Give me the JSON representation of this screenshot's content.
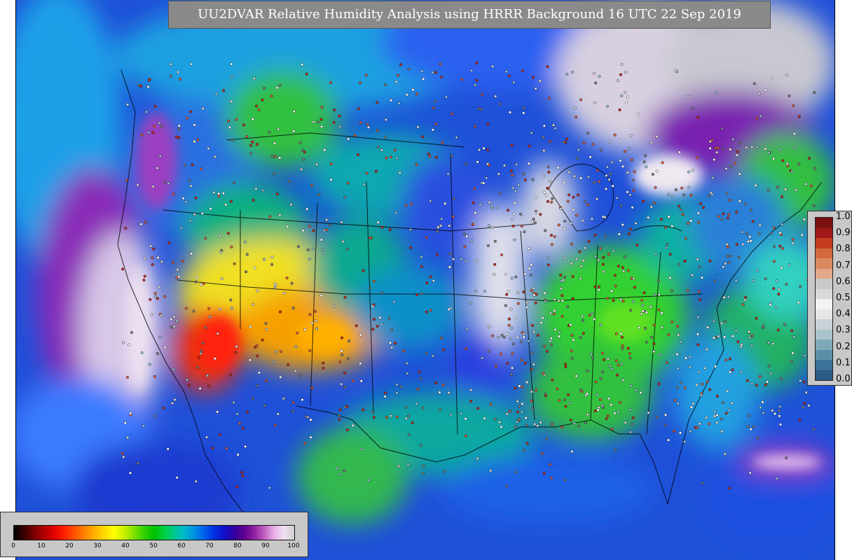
{
  "title": "UU2DVAR Relative Humidity Analysis using HRRR Background 16 UTC 22 Sep 2019",
  "bias_legend": {
    "ticks": [
      "1.0",
      "0.9",
      "0.8",
      "0.7",
      "0.6",
      "0.5",
      "0.4",
      "0.3",
      "0.2",
      "0.1",
      "0.0"
    ],
    "colors": [
      "#2b5a86",
      "#3d7398",
      "#5a8ea8",
      "#7eaab8",
      "#a9c3cc",
      "#c8d2d6",
      "#e6e6e6",
      "#f2f2f2",
      "#d8d8d8",
      "#c8c8c8",
      "#e3a88a",
      "#d98860",
      "#d2683c",
      "#c43c20",
      "#a01818",
      "#7a1010"
    ]
  },
  "rh_legend": {
    "ticks": [
      "0",
      "10",
      "20",
      "30",
      "40",
      "50",
      "60",
      "70",
      "80",
      "90",
      "100"
    ],
    "colors": [
      "#000000",
      "#3a0000",
      "#7a0000",
      "#b00000",
      "#e00000",
      "#ff2000",
      "#ff5000",
      "#ff8000",
      "#ffb000",
      "#ffd800",
      "#ffff00",
      "#c8f000",
      "#80e000",
      "#30d000",
      "#00c000",
      "#00d040",
      "#00c890",
      "#00b8c8",
      "#0090e0",
      "#0060f0",
      "#0030e0",
      "#1010c8",
      "#3000a0",
      "#600090",
      "#9020a0",
      "#c060c0",
      "#e8b0e8",
      "#f0e0f0",
      "#d0d0d0"
    ]
  },
  "colors": {
    "ocean_deep": "#1a40d0",
    "ocean_mid": "#2c6ef0",
    "ocean_light": "#1ea0e8",
    "land_green": "#30c848",
    "land_teal": "#10a8a0",
    "dry_yellow": "#f0e020",
    "dry_orange": "#f5a000",
    "dry_red": "#ee2010",
    "moist_purple": "#7a1ab0",
    "moist_white": "#e8e8ee"
  }
}
